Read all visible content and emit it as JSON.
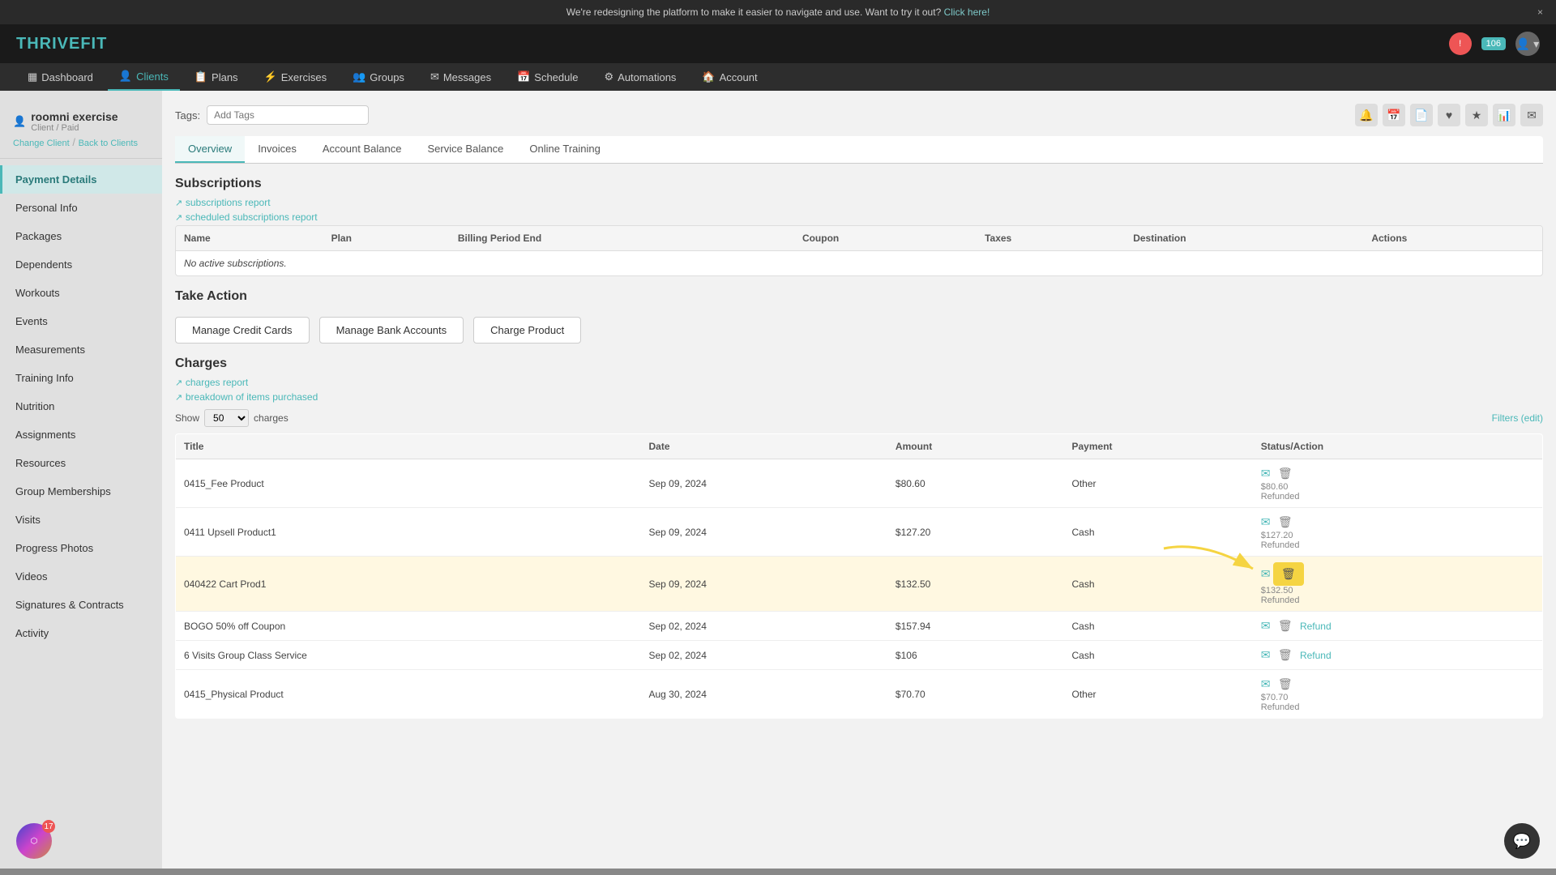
{
  "banner": {
    "text": "We're redesigning the platform to make it easier to navigate and use. Want to try it out?",
    "link_text": "Click here!",
    "close_label": "×"
  },
  "navbar": {
    "logo": "THRIVEFIT",
    "badge_count": "106",
    "avatar_icon": "👤"
  },
  "menubar": {
    "items": [
      {
        "label": "Dashboard",
        "icon": "▦",
        "active": false
      },
      {
        "label": "Clients",
        "icon": "👤",
        "active": true
      },
      {
        "label": "Plans",
        "icon": "📋",
        "active": false
      },
      {
        "label": "Exercises",
        "icon": "⚡",
        "active": false
      },
      {
        "label": "Groups",
        "icon": "👥",
        "active": false
      },
      {
        "label": "Messages",
        "icon": "✉",
        "active": false
      },
      {
        "label": "Schedule",
        "icon": "📅",
        "active": false
      },
      {
        "label": "Automations",
        "icon": "⚙",
        "active": false
      },
      {
        "label": "Account",
        "icon": "🏠",
        "active": false
      }
    ]
  },
  "sidebar": {
    "client_name": "roomni exercise",
    "client_role": "Client / Paid",
    "change_client": "Change Client",
    "back_to_clients": "Back to Clients",
    "items": [
      {
        "label": "Payment Details",
        "active": true
      },
      {
        "label": "Personal Info",
        "active": false
      },
      {
        "label": "Packages",
        "active": false
      },
      {
        "label": "Dependents",
        "active": false
      },
      {
        "label": "Workouts",
        "active": false
      },
      {
        "label": "Events",
        "active": false
      },
      {
        "label": "Measurements",
        "active": false
      },
      {
        "label": "Training Info",
        "active": false
      },
      {
        "label": "Nutrition",
        "active": false
      },
      {
        "label": "Assignments",
        "active": false
      },
      {
        "label": "Resources",
        "active": false
      },
      {
        "label": "Group Memberships",
        "active": false
      },
      {
        "label": "Visits",
        "active": false
      },
      {
        "label": "Progress Photos",
        "active": false
      },
      {
        "label": "Videos",
        "active": false
      },
      {
        "label": "Signatures & Contracts",
        "active": false
      },
      {
        "label": "Activity",
        "active": false
      }
    ]
  },
  "content": {
    "tags_label": "Tags:",
    "tags_placeholder": "Add Tags",
    "tabs": [
      {
        "label": "Overview",
        "active": true
      },
      {
        "label": "Invoices",
        "active": false
      },
      {
        "label": "Account Balance",
        "active": false
      },
      {
        "label": "Service Balance",
        "active": false
      },
      {
        "label": "Online Training",
        "active": false
      }
    ],
    "subscriptions": {
      "title": "Subscriptions",
      "link1": "subscriptions report",
      "link2": "scheduled subscriptions report",
      "table_headers": [
        "Name",
        "Plan",
        "Billing Period End",
        "Coupon",
        "Taxes",
        "Destination",
        "Actions"
      ],
      "empty_message": "No active subscriptions."
    },
    "take_action": {
      "title": "Take Action",
      "buttons": [
        {
          "label": "Manage Credit Cards"
        },
        {
          "label": "Manage Bank Accounts"
        },
        {
          "label": "Charge Product"
        }
      ]
    },
    "charges": {
      "title": "Charges",
      "link1": "charges report",
      "link2": "breakdown of items purchased",
      "show_label": "Show",
      "show_value": "50",
      "charges_label": "charges",
      "filters_label": "Filters (edit)",
      "table_headers": [
        "Title",
        "Date",
        "Amount",
        "Payment",
        "Status/Action"
      ],
      "rows": [
        {
          "title": "0415_Fee Product",
          "date": "Sep 09, 2024",
          "amount": "$80.60",
          "payment": "Other",
          "status": "$80.60",
          "status2": "Refunded",
          "highlighted": false
        },
        {
          "title": "0411 Upsell Product1",
          "date": "Sep 09, 2024",
          "amount": "$127.20",
          "payment": "Cash",
          "status": "$127.20",
          "status2": "Refunded",
          "highlighted": false
        },
        {
          "title": "040422 Cart Prod1",
          "date": "Sep 09, 2024",
          "amount": "$132.50",
          "payment": "Cash",
          "status": "$132.50",
          "status2": "Refunded",
          "highlighted": true
        },
        {
          "title": "BOGO 50% off Coupon",
          "date": "Sep 02, 2024",
          "amount": "$157.94",
          "payment": "Cash",
          "status": "Refund",
          "status2": "",
          "highlighted": false
        },
        {
          "title": "6 Visits Group Class Service",
          "date": "Sep 02, 2024",
          "amount": "$106",
          "payment": "Cash",
          "status": "Refund",
          "status2": "",
          "highlighted": false
        },
        {
          "title": "0415_Physical Product",
          "date": "Aug 30, 2024",
          "amount": "$70.70",
          "payment": "Other",
          "status": "$70.70",
          "status2": "Refunded",
          "highlighted": false
        }
      ]
    }
  },
  "bottom_left": {
    "badge": "17"
  },
  "icons": {
    "bell": "🔔",
    "calendar": "📅",
    "file": "📄",
    "heart": "♥",
    "star": "★",
    "chart": "📊",
    "mail": "✉",
    "email_icon": "✉",
    "delete_icon": "🗑",
    "external_link": "↗"
  }
}
